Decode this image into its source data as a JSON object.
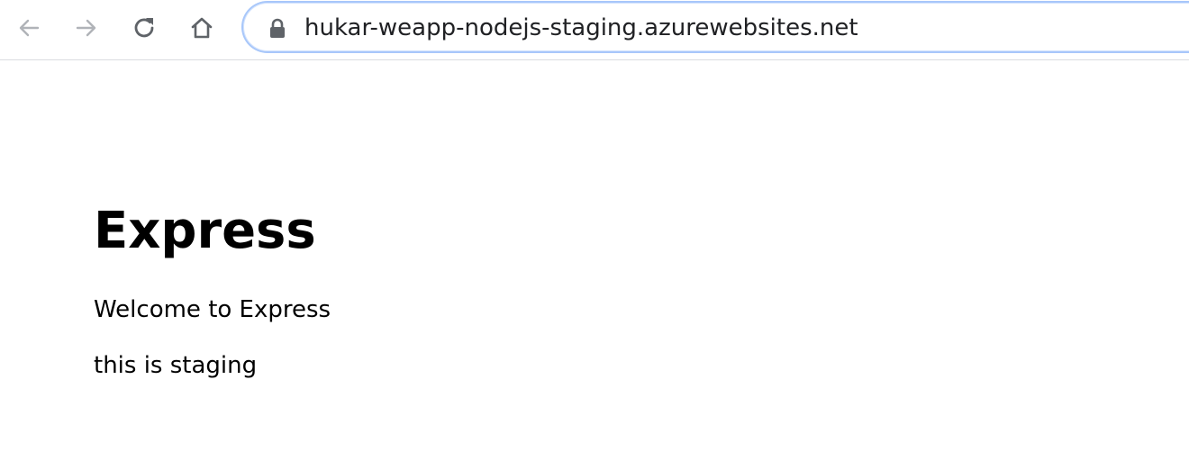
{
  "browser": {
    "url": "hukar-weapp-nodejs-staging.azurewebsites.net",
    "icons": {
      "back": "back-arrow-icon",
      "forward": "forward-arrow-icon",
      "reload": "reload-icon",
      "home": "home-icon",
      "lock": "lock-icon"
    }
  },
  "page": {
    "heading": "Express",
    "paragraphs": [
      "Welcome to Express",
      "this is staging"
    ]
  }
}
